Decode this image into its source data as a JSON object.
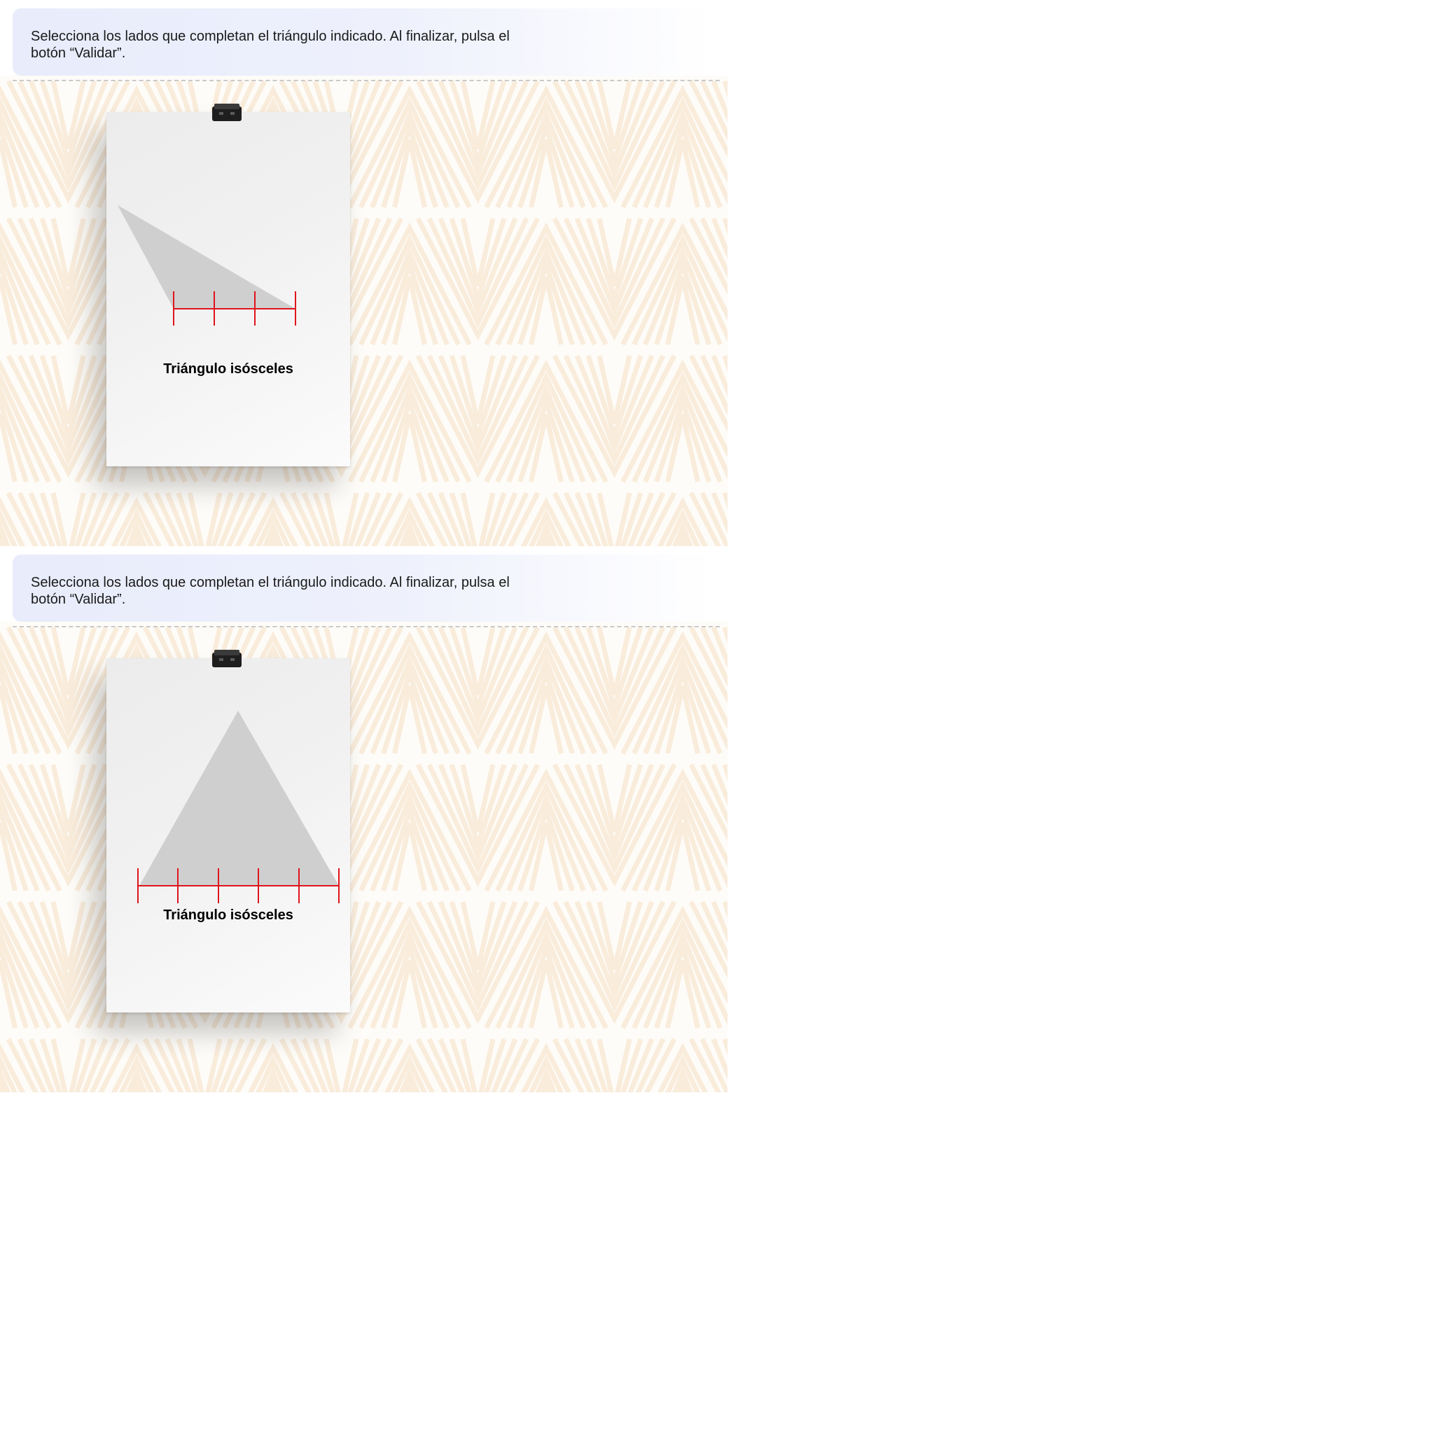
{
  "activities": [
    {
      "instruction": "Selecciona los lados que completan el triángulo indicado. Al finalizar, pulsa el botón “Validar”.",
      "card_title": "Triángulo isósceles",
      "ruler_segments": 3
    },
    {
      "instruction": "Selecciona los lados que completan el triángulo indicado. Al finalizar, pulsa el botón “Validar”.",
      "card_title": "Triángulo isósceles",
      "ruler_segments": 5
    }
  ],
  "colors": {
    "triangle_fill": "#cfcfcf",
    "ruler": "#e0141c",
    "pattern": "#f9ecdb",
    "instruction_bg": "#e8ecfb"
  },
  "icons": {
    "clip": "binder-clip-icon"
  }
}
